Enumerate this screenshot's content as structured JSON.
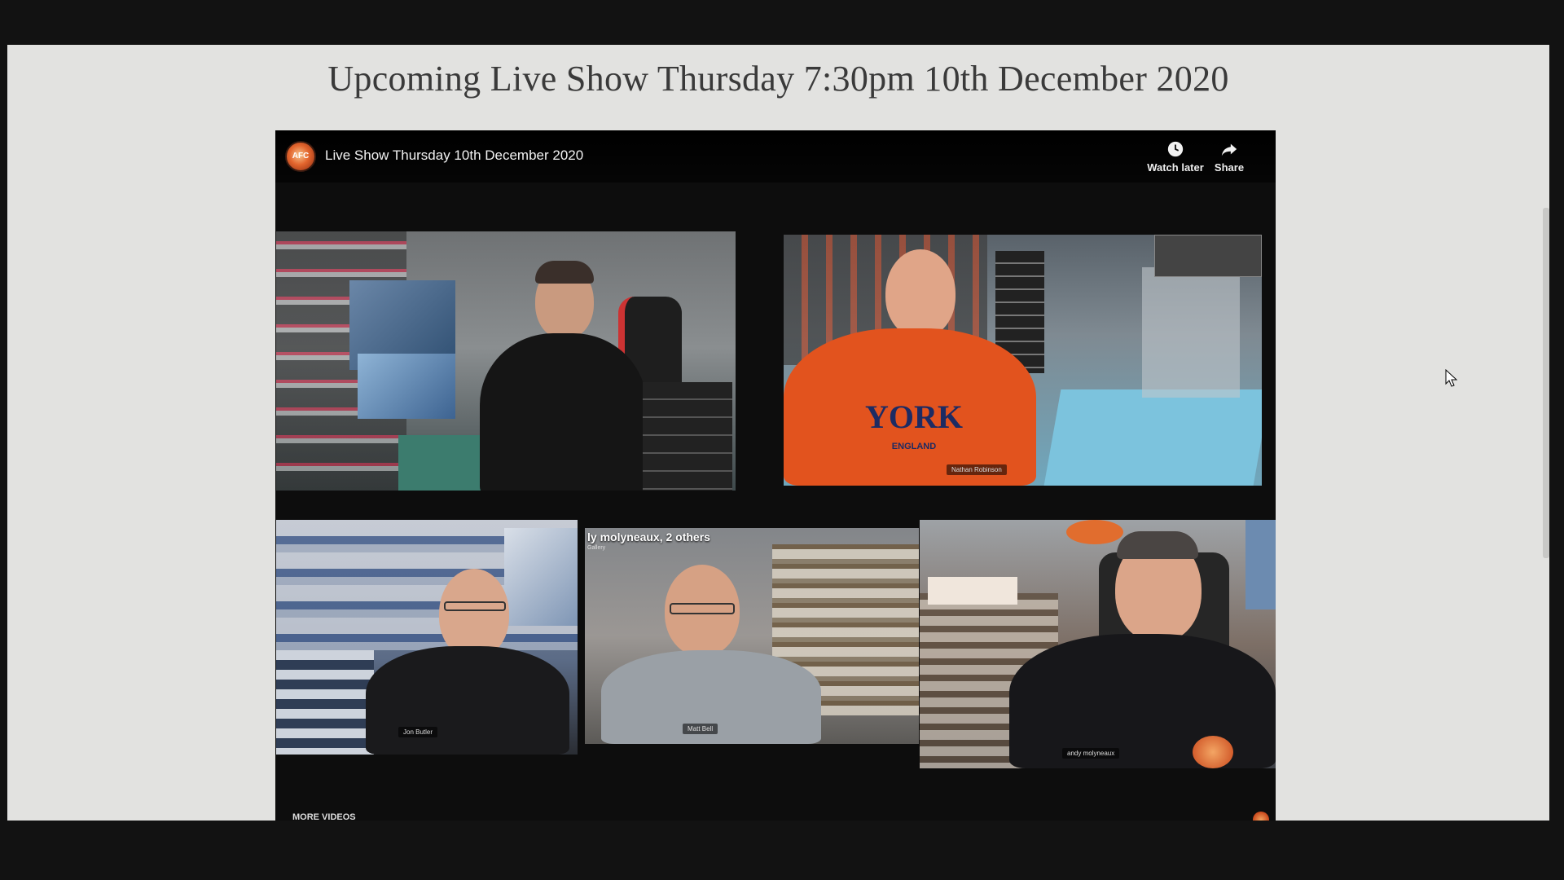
{
  "page": {
    "title": "Upcoming Live Show Thursday 7:30pm 10th December 2020"
  },
  "player": {
    "channel_logo_text": "AFC",
    "video_title": "Live Show Thursday 10th December 2020",
    "watch_later_label": "Watch later",
    "share_label": "Share",
    "more_videos_label": "MORE VIDEOS",
    "watch_later_icon": "clock-icon",
    "share_icon": "share-arrow-icon"
  },
  "video_frame": {
    "participants": [
      {
        "tag": ""
      },
      {
        "tag": "Nathan Robinson"
      },
      {
        "tag": "Jon Butler"
      },
      {
        "tag": "Matt Bell"
      },
      {
        "tag": "andy molyneaux"
      }
    ],
    "overlay_caption": "ly molyneaux, 2 others",
    "overlay_sub": "Gallery",
    "shirt_text": "YORK",
    "shirt_sub": "ENGLAND"
  },
  "colors": {
    "backdrop": "#121212",
    "page": "#e2e2e0",
    "player": "#0d0d0d"
  }
}
